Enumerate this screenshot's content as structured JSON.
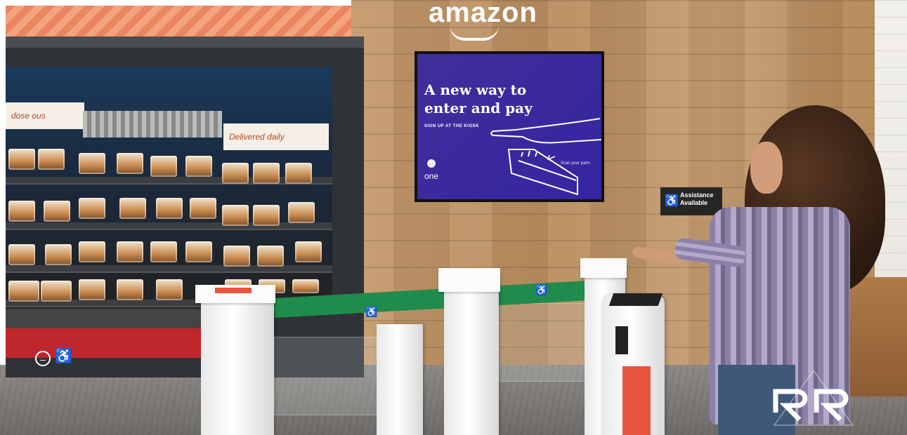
{
  "store": {
    "logo_text": "amazon"
  },
  "screen": {
    "headline": "A new way to enter and pay",
    "subline": "SIGN UP AT THE KIOSK",
    "palm_note": "Scan your palm",
    "brand": "one"
  },
  "assistance_sign": {
    "text": "Assistance Available",
    "icon": "wheelchair-icon"
  },
  "fridge_signs": {
    "left": "dose ous",
    "right": "Delivered daily"
  },
  "colors": {
    "screen_bg": "#3a2a9e",
    "green_rope": "#1f8b4c",
    "red_rope": "#c0272d"
  }
}
